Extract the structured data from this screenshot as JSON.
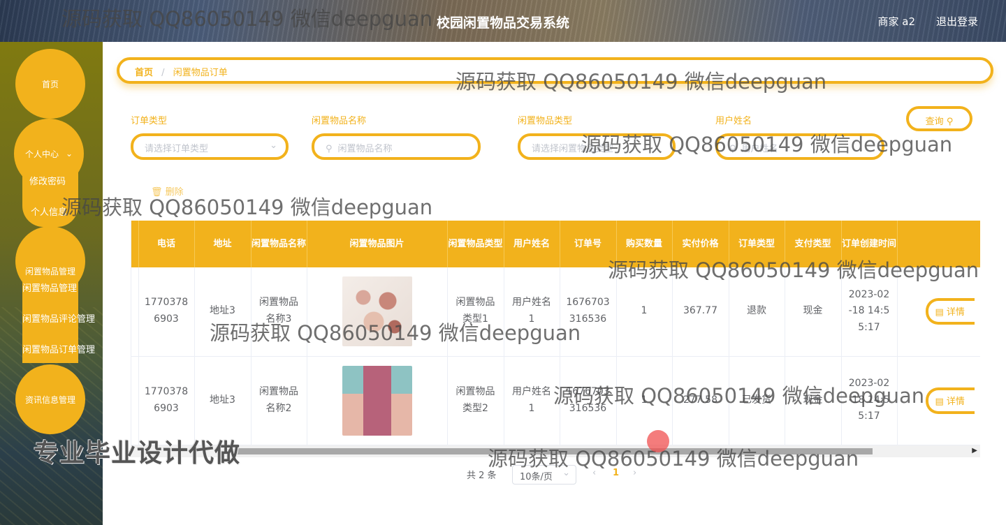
{
  "header": {
    "title": "校园闲置物品交易系统",
    "user": "商家 a2",
    "logout": "退出登录"
  },
  "sidebar": {
    "home": "首页",
    "personal": "个人中心",
    "personal_items": [
      "修改密码",
      "个人信息"
    ],
    "goods_mgmt": "闲置物品管理",
    "goods_items": [
      "闲置物品管理",
      "闲置物品评论管理",
      "闲置物品订单管理"
    ],
    "news_mgmt": "资讯信息管理",
    "promo": "专业毕业设计代做"
  },
  "breadcrumb": {
    "home": "首页",
    "sep": "/",
    "current": "闲置物品订单"
  },
  "filters": {
    "order_type_label": "订单类型",
    "order_type_placeholder": "请选择订单类型",
    "goods_name_label": "闲置物品名称",
    "goods_name_placeholder": "闲置物品名称",
    "goods_type_label": "闲置物品类型",
    "goods_type_placeholder": "请选择闲置物品类型",
    "user_name_label": "用户姓名",
    "user_name_placeholder": "用户姓名",
    "query_button": "查询"
  },
  "actions": {
    "delete": "删除"
  },
  "table": {
    "headers": [
      "电话",
      "地址",
      "闲置物品名称",
      "闲置物品图片",
      "闲置物品类型",
      "用户姓名",
      "订单号",
      "购买数量",
      "实付价格",
      "订单类型",
      "支付类型",
      "订单创建时间",
      ""
    ],
    "rows": [
      {
        "phone": "17703786903",
        "address": "地址3",
        "goods_name": "闲置物品名称3",
        "image": "cosmetics",
        "goods_type": "闲置物品类型1",
        "user_name": "用户姓名1",
        "order_no": "1676703316536",
        "qty": "1",
        "price": "367.77",
        "order_type": "退款",
        "pay_type": "现金",
        "created": "2023-02-18 14:55:17",
        "action": "详情"
      },
      {
        "phone": "17703786903",
        "address": "地址3",
        "goods_name": "闲置物品名称2",
        "image": "dress",
        "goods_type": "闲置物品类型2",
        "user_name": "用户姓名1",
        "order_no": "1676703316536",
        "qty": "1",
        "price": "277.58",
        "order_type": "已发货",
        "pay_type": "现金",
        "created": "2023-02-18 14:55:17",
        "action": "详情"
      }
    ]
  },
  "pagination": {
    "total": "共 2 条",
    "page_size": "10条/页",
    "current_page": "1",
    "prev": "‹",
    "next": "›"
  },
  "watermark": "源码获取 QQ86050149 微信deepguan",
  "colors": {
    "accent": "#f2b21c",
    "header_text": "#ffffff"
  }
}
